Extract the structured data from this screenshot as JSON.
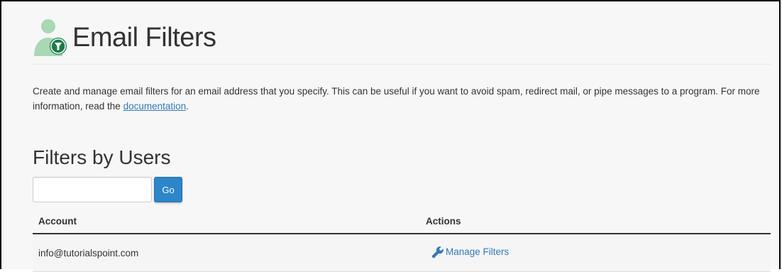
{
  "header": {
    "title": "Email Filters",
    "icon": "user-filter-icon"
  },
  "intro": {
    "text_before": "Create and manage email filters for an email address that you specify. This can be useful if you want to avoid spam, redirect mail, or pipe messages to a program. For more information, read the ",
    "link_text": "documentation",
    "text_after": "."
  },
  "section": {
    "title": "Filters by Users"
  },
  "search": {
    "value": "",
    "placeholder": "",
    "button_label": "Go"
  },
  "table": {
    "headers": {
      "account": "Account",
      "actions": "Actions"
    },
    "rows": [
      {
        "account": "info@tutorialspoint.com",
        "action_label": "Manage Filters",
        "action_icon": "wrench-icon"
      }
    ]
  },
  "colors": {
    "accent": "#2c86c9",
    "link": "#337ab7",
    "icon_green": "#a8d8b4",
    "icon_dark_green": "#1d7a4b"
  }
}
